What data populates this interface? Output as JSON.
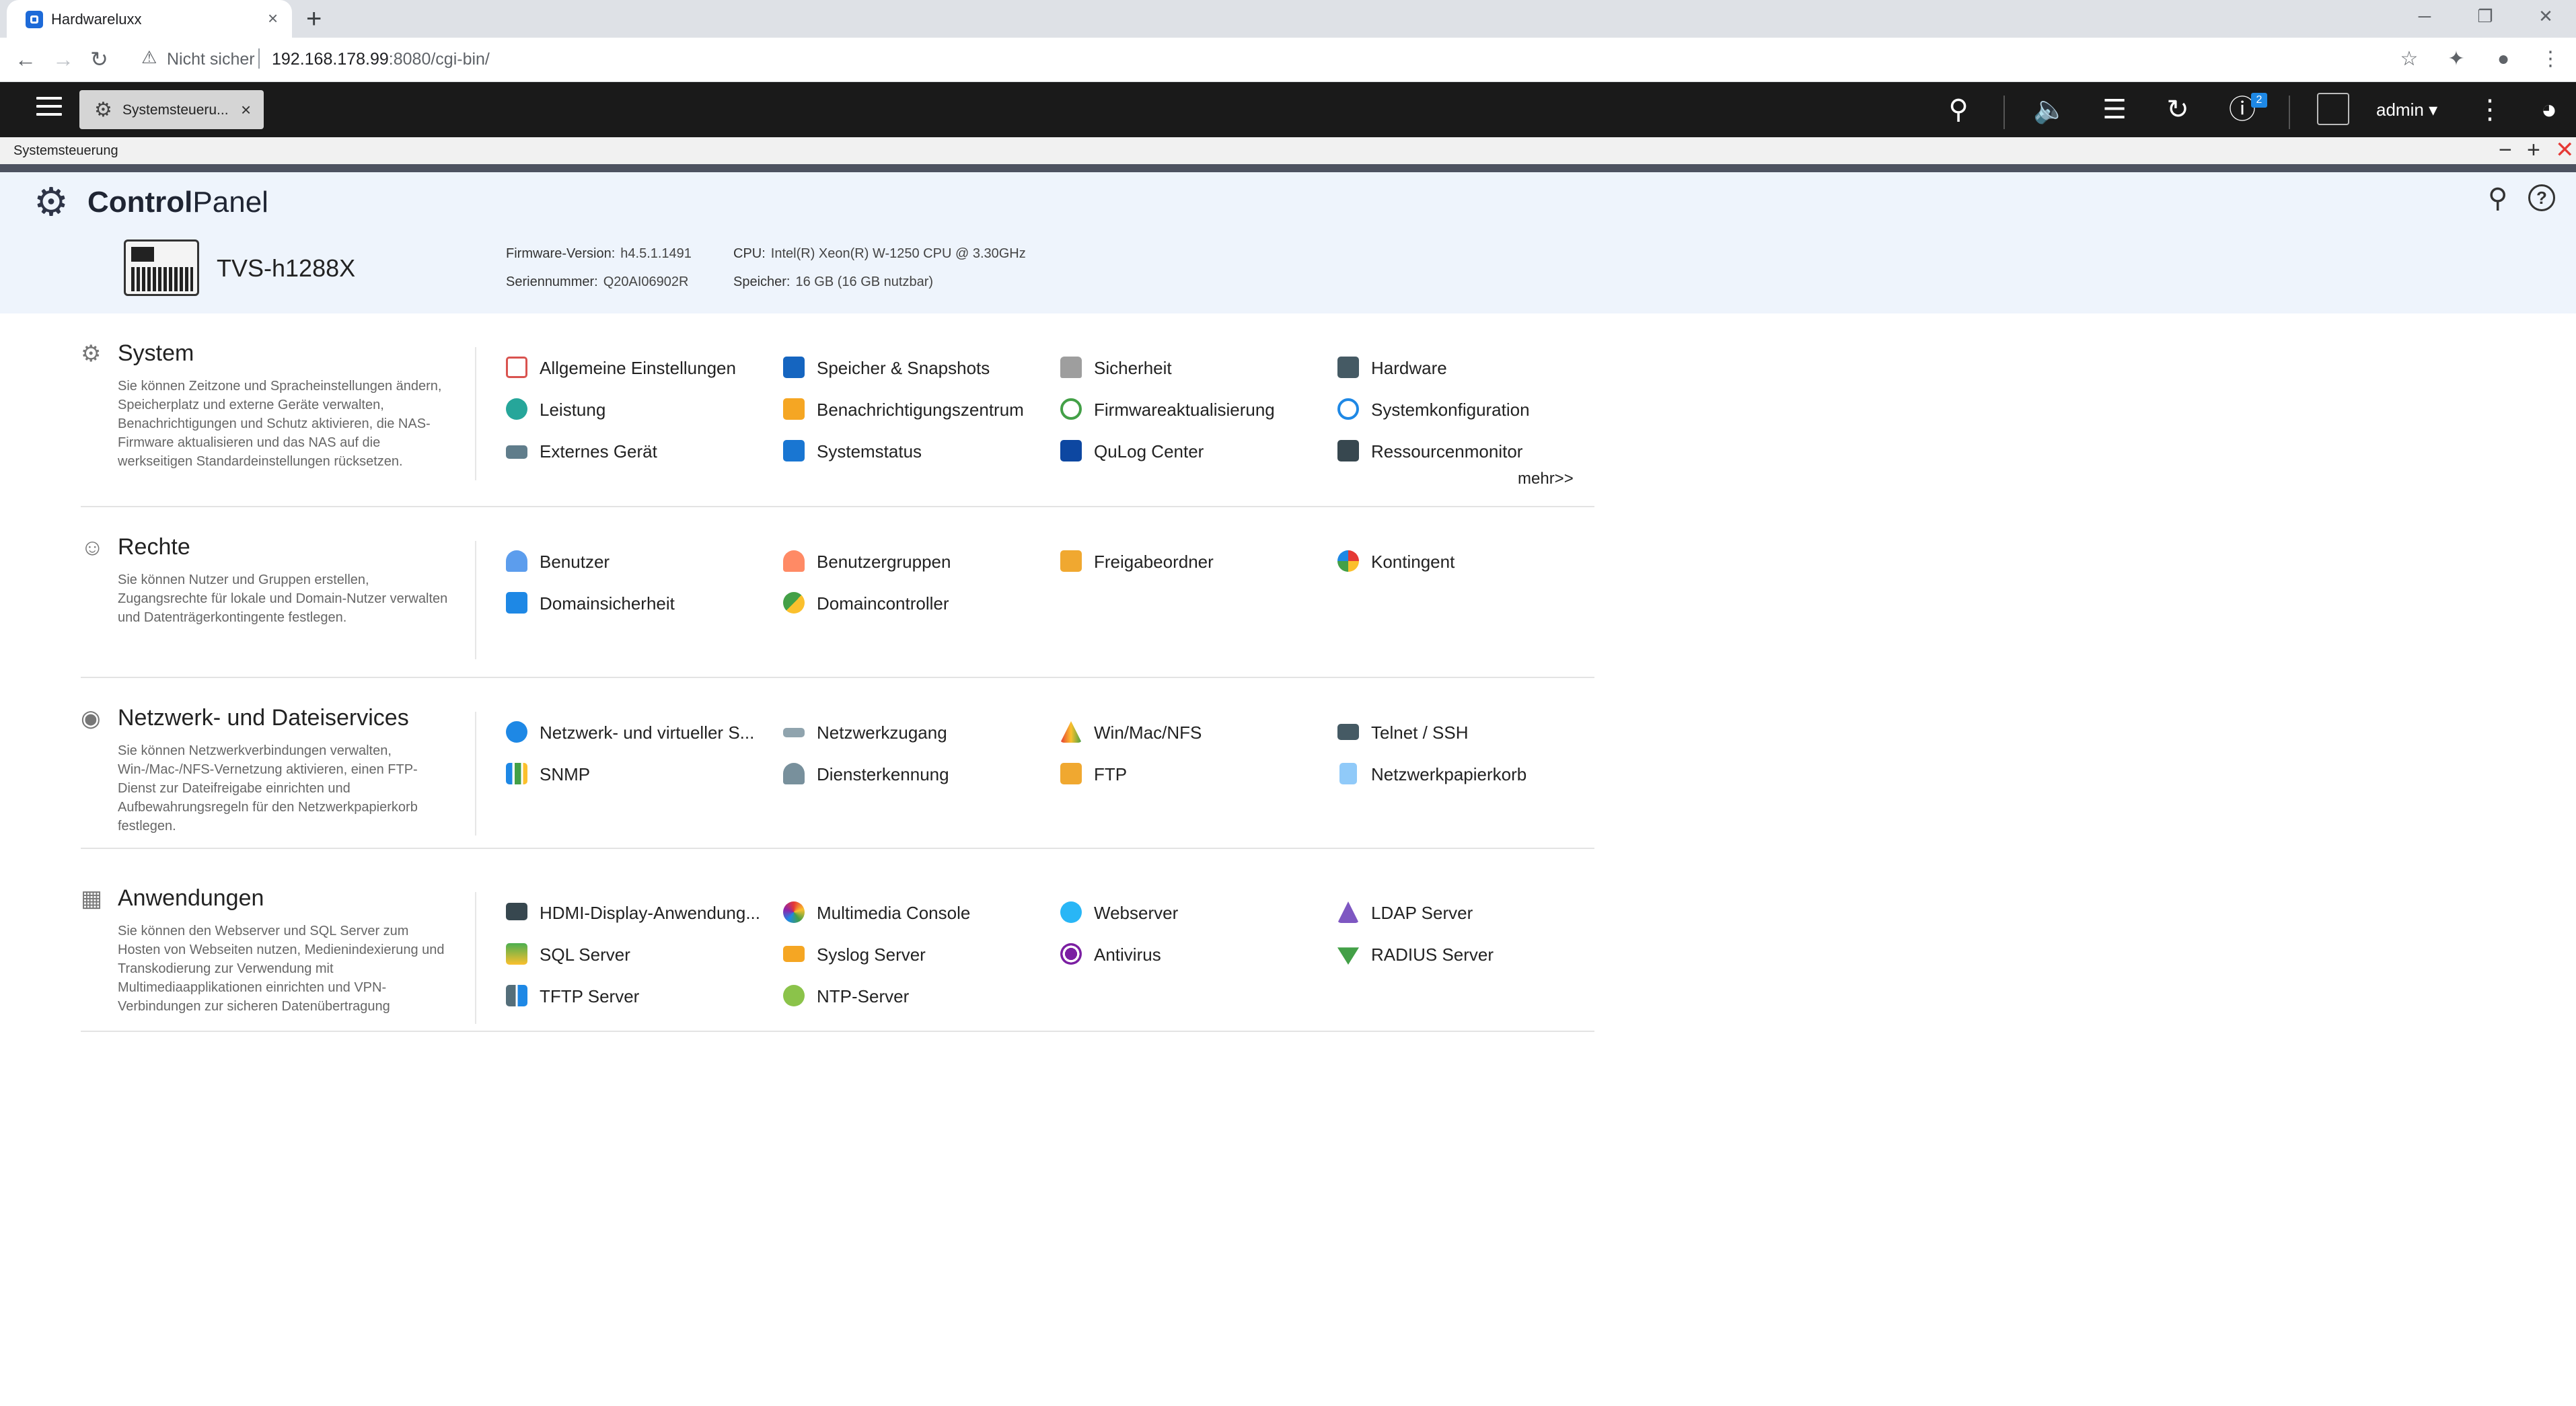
{
  "browser": {
    "tab_title": "Hardwareluxx",
    "tab_close": "×",
    "new_tab": "+",
    "insecure_label": "Nicht sicher",
    "url_host": "192.168.178.99",
    "url_rest": ":8080/cgi-bin/",
    "win_min": "─",
    "win_restore": "❐",
    "win_close": "✕"
  },
  "qts": {
    "app_tab_label": "Systemsteueru...",
    "app_tab_close": "×",
    "notification_count": "2",
    "user_name": "admin",
    "user_caret": "▾"
  },
  "window": {
    "title": "Systemsteuerung",
    "min": "−",
    "max": "+",
    "close": "✕"
  },
  "header": {
    "title_bold": "Control",
    "title_light": "Panel",
    "device_name": "TVS-h1288X",
    "firmware_label": "Firmware-Version:",
    "firmware_value": "h4.5.1.1491",
    "serial_label": "Seriennummer:",
    "serial_value": "Q20AI06902R",
    "cpu_label": "CPU:",
    "cpu_value": "Intel(R) Xeon(R) W-1250 CPU @ 3.30GHz",
    "memory_label": "Speicher:",
    "memory_value": "16 GB (16 GB nutzbar)",
    "help": "?"
  },
  "sections": [
    {
      "title": "System",
      "icon": "gear-icon",
      "description": "Sie können Zeitzone und Spracheinstellungen ändern, Speicherplatz und externe Geräte verwalten, Benachrichtigungen und Schutz aktivieren, die NAS-Firmware aktualisieren und das NAS auf die werkseitigen Standardeinstellungen rücksetzen.",
      "items": [
        "Allgemeine Einstellungen",
        "Speicher & Snapshots",
        "Sicherheit",
        "Hardware",
        "Leistung",
        "Benachrichtigungszentrum",
        "Firmwareaktualisierung",
        "Systemkonfiguration",
        "Externes Gerät",
        "Systemstatus",
        "QuLog Center",
        "Ressourcenmonitor"
      ],
      "more": "mehr>>"
    },
    {
      "title": "Rechte",
      "icon": "user-icon",
      "description": "Sie können Nutzer und Gruppen erstellen, Zugangsrechte für lokale und Domain-Nutzer verwalten und Datenträgerkontingente festlegen.",
      "items": [
        "Benutzer",
        "Benutzergruppen",
        "Freigabeordner",
        "Kontingent",
        "Domainsicherheit",
        "Domaincontroller"
      ]
    },
    {
      "title": "Netzwerk- und Dateiservices",
      "icon": "globe-icon",
      "description": "Sie können Netzwerkverbindungen verwalten, Win-/Mac-/NFS-Vernetzung aktivieren, einen FTP-Dienst zur Dateifreigabe einrichten und Aufbewahrungsregeln für den Netzwerkpapierkorb festlegen.",
      "items": [
        "Netzwerk- und virtueller S...",
        "Netzwerkzugang",
        "Win/Mac/NFS",
        "Telnet / SSH",
        "SNMP",
        "Diensterkennung",
        "FTP",
        "Netzwerkpapierkorb"
      ]
    },
    {
      "title": "Anwendungen",
      "icon": "apps-icon",
      "description": "Sie können den Webserver und SQL Server zum Hosten von Webseiten nutzen, Medienindexierung und Transkodierung zur Verwendung mit Multimediaapplikationen einrichten und VPN-Verbindungen zur sicheren Datenübertragung",
      "items": [
        "HDMI-Display-Anwendung...",
        "Multimedia Console",
        "Webserver",
        "LDAP Server",
        "SQL Server",
        "Syslog Server",
        "Antivirus",
        "RADIUS Server",
        "TFTP Server",
        "NTP-Server"
      ]
    }
  ],
  "item_icons": {
    "colors": [
      "#d9534f",
      "#1565c0",
      "#9e9e9e",
      "#455a64",
      "#26a69a",
      "#f5a623",
      "#43a047",
      "#1e88e5",
      "#607d8b",
      "#1976d2",
      "#0d47a1",
      "#37474f"
    ]
  }
}
